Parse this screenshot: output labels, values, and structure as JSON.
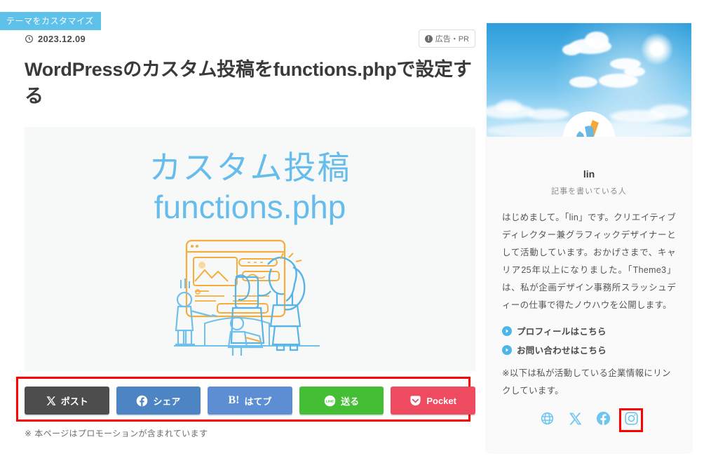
{
  "customize_bar": {
    "label": "テーマをカスタマイズ"
  },
  "article": {
    "date": "2023.12.09",
    "date_icon": "clock-icon",
    "ad_badge": {
      "icon": "info-circle-icon",
      "label": "広告・PR"
    },
    "title": "WordPressのカスタム投稿をfunctions.phpで設定する",
    "hero": {
      "line1": "カスタム投稿",
      "line2": "functions.php",
      "illustration": "people-with-browser-illustration",
      "text_color": "#66bdeb",
      "background": "#f7f8f8"
    },
    "promotion_note": "※ 本ページはプロモーションが含まれています"
  },
  "share_buttons": [
    {
      "icon": "x-twitter-icon",
      "label": "ポスト",
      "color": "#4d4d4d"
    },
    {
      "icon": "facebook-icon",
      "label": "シェア",
      "color": "#4c84c4"
    },
    {
      "icon": "hatena-icon",
      "label": "はてブ",
      "color": "#5d8ed4"
    },
    {
      "icon": "line-icon",
      "label": "送る",
      "color": "#44bf35"
    },
    {
      "icon": "pocket-icon",
      "label": "Pocket",
      "color": "#ef4b60"
    }
  ],
  "highlight": {
    "color": "#fe0000",
    "targets": [
      "share-buttons-row",
      "social-link-instagram"
    ]
  },
  "sidebar": {
    "cover_image": "blue-sky-with-clouds-photo",
    "avatar": "person-holding-pencil-avatar",
    "name": "lin",
    "role": "記事を書いている人",
    "bio": "はじめまして。「lin」です。クリエイティブディレクター兼グラフィックデザイナーとして活動しています。おかげさまで、キャリア25年以上になりました。「Theme3」は、私が企画デザイン事務所スラッシュディーの仕事で得たノウハウを公開します。",
    "links": [
      {
        "icon": "arrow-circle-icon",
        "label": "プロフィールはこちら"
      },
      {
        "icon": "arrow-circle-icon",
        "label": "お問い合わせはこちら"
      }
    ],
    "note": "※以下は私が活動している企業情報にリンクしています。",
    "socials": [
      {
        "icon": "globe-icon",
        "name": "website"
      },
      {
        "icon": "x-twitter-icon",
        "name": "x"
      },
      {
        "icon": "facebook-icon",
        "name": "facebook"
      },
      {
        "icon": "instagram-icon",
        "name": "instagram"
      }
    ],
    "accent_color": "#6ec6f0"
  }
}
